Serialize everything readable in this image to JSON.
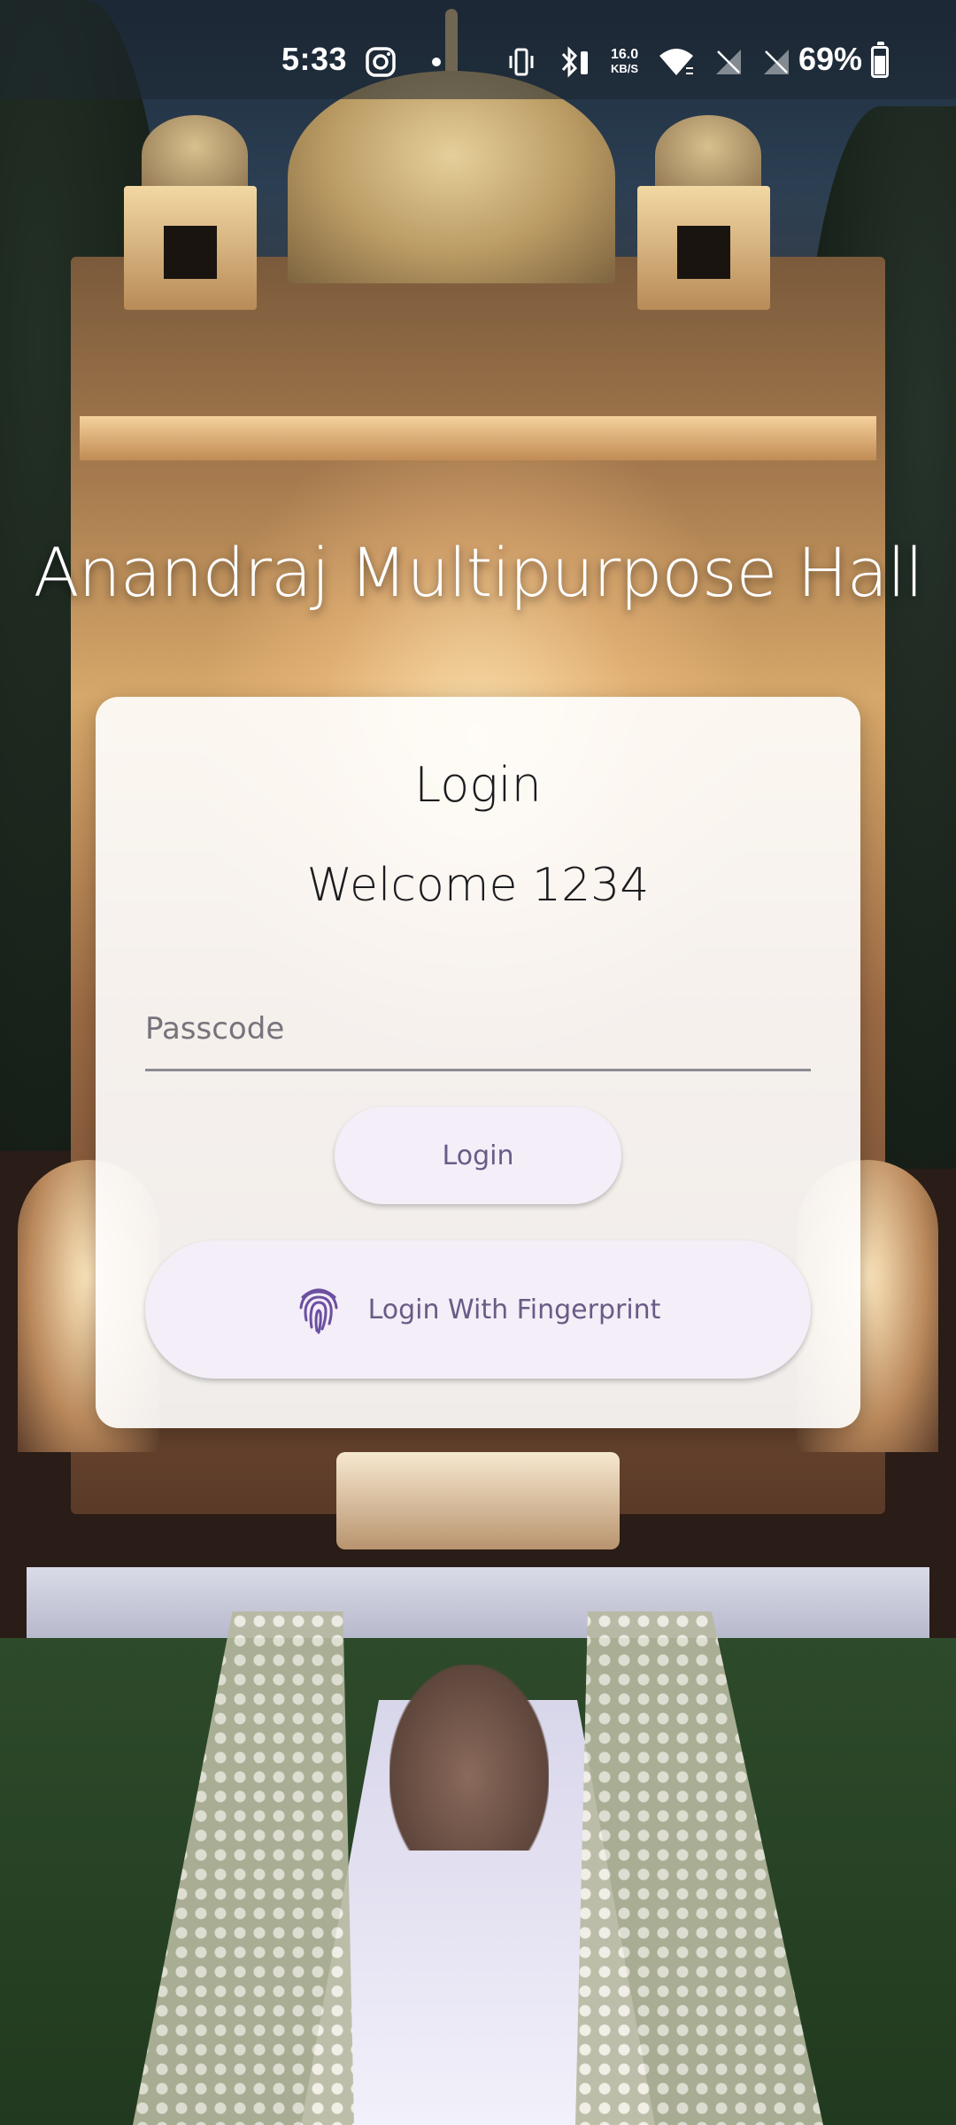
{
  "status_bar": {
    "time": "5:33",
    "net_speed_value": "16.0",
    "net_speed_unit": "KB/S",
    "battery": "69%",
    "icons": [
      "instagram-icon",
      "notification-dot-icon",
      "vibrate-icon",
      "bluetooth-icon",
      "wifi-icon",
      "no-signal-icon",
      "no-signal-icon",
      "battery-icon"
    ]
  },
  "app": {
    "title": "Anandraj Multipurpose Hall"
  },
  "login_card": {
    "heading": "Login",
    "welcome": "Welcome 1234",
    "passcode_placeholder": "Passcode",
    "passcode_value": "",
    "login_button": "Login",
    "fingerprint_button": "Login With Fingerprint",
    "fingerprint_icon": "fingerprint-icon"
  },
  "colors": {
    "button_bg": "#f4eef8",
    "button_text": "#6a5b85",
    "fingerprint_icon": "#6b4fa0"
  }
}
